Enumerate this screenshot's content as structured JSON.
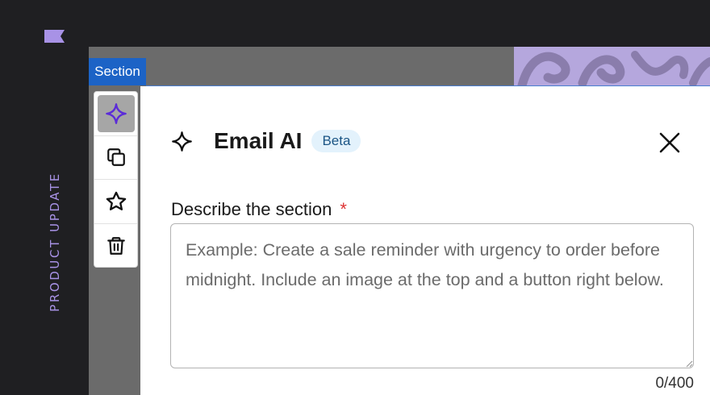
{
  "sidebar": {
    "vertical_label": "PRODUCT UPDATE"
  },
  "editor": {
    "section_tab_label": "Section"
  },
  "toolbar": {
    "buttons": [
      {
        "icon": "sparkle-icon",
        "active": true
      },
      {
        "icon": "copy-icon",
        "active": false
      },
      {
        "icon": "star-icon",
        "active": false
      },
      {
        "icon": "trash-icon",
        "active": false
      }
    ]
  },
  "dialog": {
    "title": "Email AI",
    "badge": "Beta",
    "field_label": "Describe the section",
    "required_mark": "*",
    "textarea_placeholder": "Example: Create a sale reminder with urgency to order before midnight. Include an image at the top and a button right below.",
    "textarea_value": "",
    "char_counter": "0/400"
  },
  "colors": {
    "accent_blue": "#1c63c6",
    "brand_purple": "#a892e6",
    "icon_purple": "#5b2bd8",
    "badge_bg": "#e3f2fc",
    "required_red": "#dd3333"
  }
}
